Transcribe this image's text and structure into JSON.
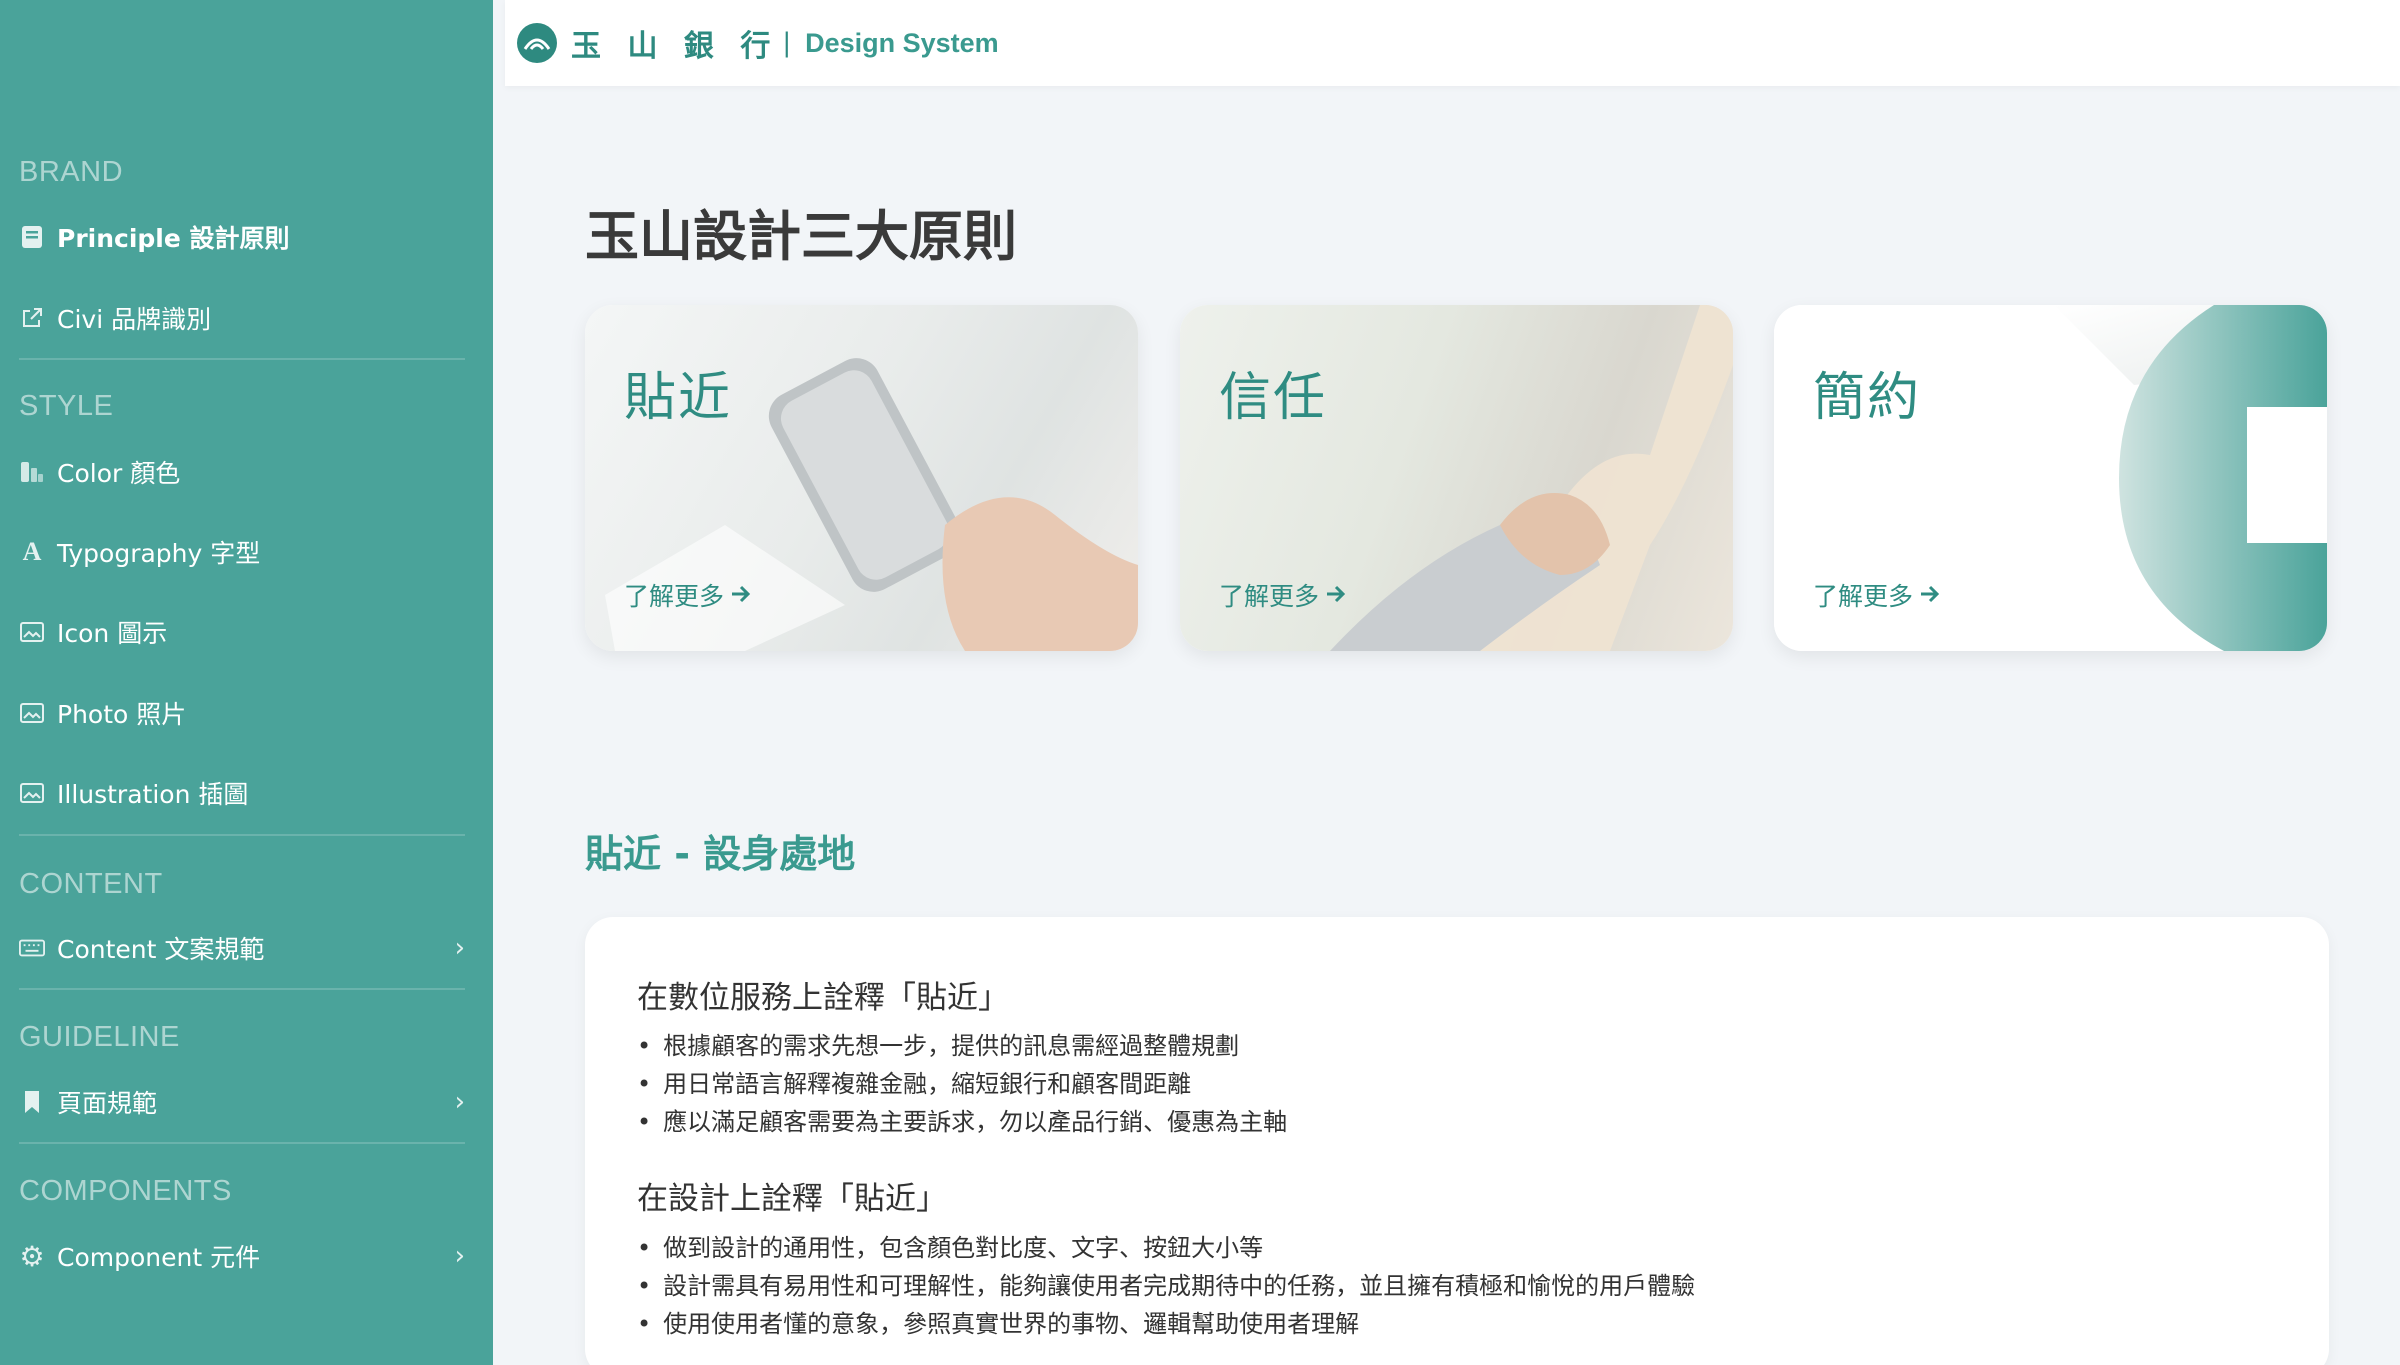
{
  "brand": {
    "name": "玉 山 銀 行",
    "separator": "|",
    "product": "Design System",
    "accent": "#2e8a80",
    "sidebar_bg": "#4aa39a"
  },
  "sidebar": {
    "sections": [
      {
        "heading": "BRAND"
      },
      {
        "heading": "STYLE"
      },
      {
        "heading": "CONTENT"
      },
      {
        "heading": "GUIDELINE"
      },
      {
        "heading": "COMPONENTS"
      }
    ],
    "items": [
      {
        "label": "Principle 設計原則",
        "icon": "book-icon",
        "active": true
      },
      {
        "label": "Civi 品牌識別",
        "icon": "external-link-icon"
      },
      {
        "label": "Color 顏色",
        "icon": "palette-icon"
      },
      {
        "label": "Typography 字型",
        "icon": "font-icon"
      },
      {
        "label": "Icon 圖示",
        "icon": "image-icon"
      },
      {
        "label": "Photo 照片",
        "icon": "image-icon"
      },
      {
        "label": "Illustration 插圖",
        "icon": "image-icon"
      },
      {
        "label": "Content 文案規範",
        "icon": "keyboard-icon"
      },
      {
        "label": "頁面規範",
        "icon": "bookmark-icon"
      },
      {
        "label": "Component 元件",
        "icon": "gear-icon"
      }
    ]
  },
  "main": {
    "title": "玉山設計三大原則",
    "cards": [
      {
        "title": "貼近",
        "link": "了解更多"
      },
      {
        "title": "信任",
        "link": "了解更多"
      },
      {
        "title": "簡約",
        "link": "了解更多"
      }
    ],
    "section_title": "貼近 - 設身處地",
    "blocks": [
      {
        "heading": "在數位服務上詮釋「貼近」",
        "bullets": [
          "根據顧客的需求先想一步，提供的訊息需經過整體規劃",
          "用日常語言解釋複雜金融，縮短銀行和顧客間距離",
          "應以滿足顧客需要為主要訴求，勿以產品行銷、優惠為主軸"
        ]
      },
      {
        "heading": "在設計上詮釋「貼近」",
        "bullets": [
          "做到設計的通用性，包含顏色對比度、文字、按鈕大小等",
          "設計需具有易用性和可理解性，能夠讓使用者完成期待中的任務，並且擁有積極和愉悅的用戶體驗",
          "使用使用者懂的意象，參照真實世界的事物、邏輯幫助使用者理解"
        ]
      }
    ]
  }
}
